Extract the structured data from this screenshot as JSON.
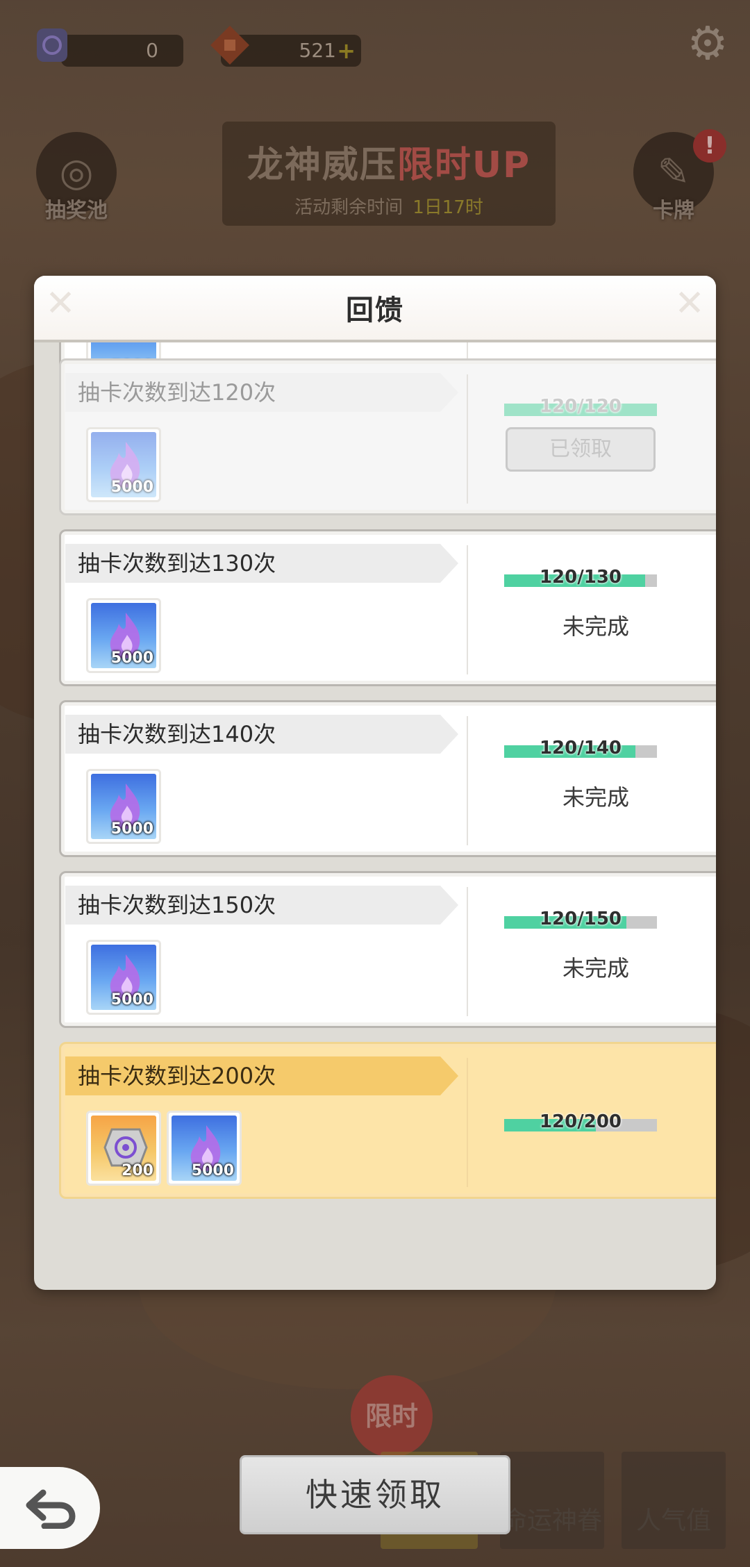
{
  "top_bar": {
    "gem_count": "0",
    "diamond_count": "521",
    "diamond_plus": "+",
    "icons": {
      "gem": "rune-stone-icon",
      "diamond": "red-diamond-icon",
      "settings": "gear-icon"
    }
  },
  "banner": {
    "title_main": "龙神威压",
    "title_up": "限时UP",
    "remaining_label": "活动剩余时间",
    "remaining_time": "1日17时"
  },
  "side_buttons": {
    "draw_pool": "抽奖池",
    "cards": "卡牌",
    "cards_badge": "!"
  },
  "modal": {
    "title": "回馈",
    "partial_item_count": "5000",
    "tasks": [
      {
        "name": "抽卡次数到达120次",
        "progress_text": "120/120",
        "progress": 1.0,
        "status": "已领取",
        "items": [
          {
            "type": "flame",
            "count": "5000"
          }
        ]
      },
      {
        "name": "抽卡次数到达130次",
        "progress_text": "120/130",
        "progress": 0.923,
        "status": "未完成",
        "items": [
          {
            "type": "flame",
            "count": "5000"
          }
        ]
      },
      {
        "name": "抽卡次数到达140次",
        "progress_text": "120/140",
        "progress": 0.857,
        "status": "未完成",
        "items": [
          {
            "type": "flame",
            "count": "5000"
          }
        ]
      },
      {
        "name": "抽卡次数到达150次",
        "progress_text": "120/150",
        "progress": 0.8,
        "status": "未完成",
        "items": [
          {
            "type": "flame",
            "count": "5000"
          }
        ]
      },
      {
        "name": "抽卡次数到达200次",
        "progress_text": "120/200",
        "progress": 0.6,
        "status": "",
        "items": [
          {
            "type": "rune",
            "count": "200"
          },
          {
            "type": "flame",
            "count": "5000"
          }
        ]
      }
    ]
  },
  "bottom": {
    "limited": "限时",
    "tab_fate": "命运神眷",
    "tab_popularity": "人气值",
    "quick_claim": "快速领取"
  },
  "colors": {
    "progress_fill": "#4fd1a1",
    "highlight_row": "#fde4a8",
    "highlight_label": "#f5ca6b"
  }
}
